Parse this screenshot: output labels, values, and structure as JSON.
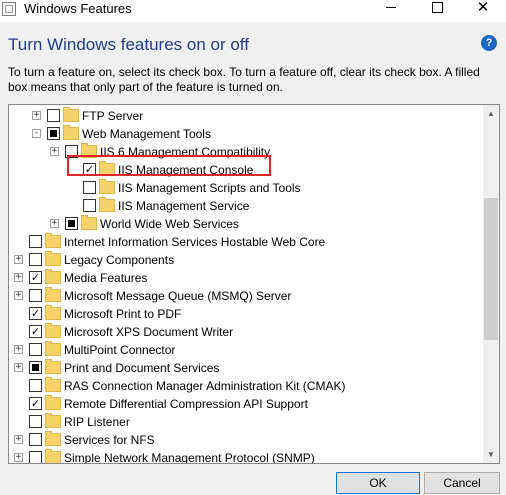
{
  "window": {
    "title": "Windows Features"
  },
  "heading": "Turn Windows features on or off",
  "description": "To turn a feature on, select its check box. To turn a feature off, clear its check box. A filled box means that only part of the feature is turned on.",
  "help_icon_label": "?",
  "features": [
    {
      "label": "FTP Server",
      "expander": "+",
      "state": "unchecked"
    },
    {
      "label": "Web Management Tools",
      "expander": "-",
      "state": "partial"
    },
    {
      "label": "IIS 6 Management Compatibility",
      "expander": "+",
      "state": "unchecked"
    },
    {
      "label": "IIS Management Console",
      "expander": "",
      "state": "checked"
    },
    {
      "label": "IIS Management Scripts and Tools",
      "expander": "",
      "state": "unchecked"
    },
    {
      "label": "IIS Management Service",
      "expander": "",
      "state": "unchecked"
    },
    {
      "label": "World Wide Web Services",
      "expander": "+",
      "state": "partial"
    },
    {
      "label": "Internet Information Services Hostable Web Core",
      "expander": "",
      "state": "unchecked"
    },
    {
      "label": "Legacy Components",
      "expander": "+",
      "state": "unchecked"
    },
    {
      "label": "Media Features",
      "expander": "+",
      "state": "checked"
    },
    {
      "label": "Microsoft Message Queue (MSMQ) Server",
      "expander": "+",
      "state": "unchecked"
    },
    {
      "label": "Microsoft Print to PDF",
      "expander": "",
      "state": "checked"
    },
    {
      "label": "Microsoft XPS Document Writer",
      "expander": "",
      "state": "checked"
    },
    {
      "label": "MultiPoint Connector",
      "expander": "+",
      "state": "unchecked"
    },
    {
      "label": "Print and Document Services",
      "expander": "+",
      "state": "partial"
    },
    {
      "label": "RAS Connection Manager Administration Kit (CMAK)",
      "expander": "",
      "state": "unchecked"
    },
    {
      "label": "Remote Differential Compression API Support",
      "expander": "",
      "state": "checked"
    },
    {
      "label": "RIP Listener",
      "expander": "",
      "state": "unchecked"
    },
    {
      "label": "Services for NFS",
      "expander": "+",
      "state": "unchecked"
    },
    {
      "label": "Simple Network Management Protocol (SNMP)",
      "expander": "+",
      "state": "unchecked"
    }
  ],
  "buttons": {
    "ok": "OK",
    "cancel": "Cancel"
  },
  "colors": {
    "heading": "#1e3d8c",
    "highlight": "#e3232a",
    "folder": "#f7d26b"
  }
}
